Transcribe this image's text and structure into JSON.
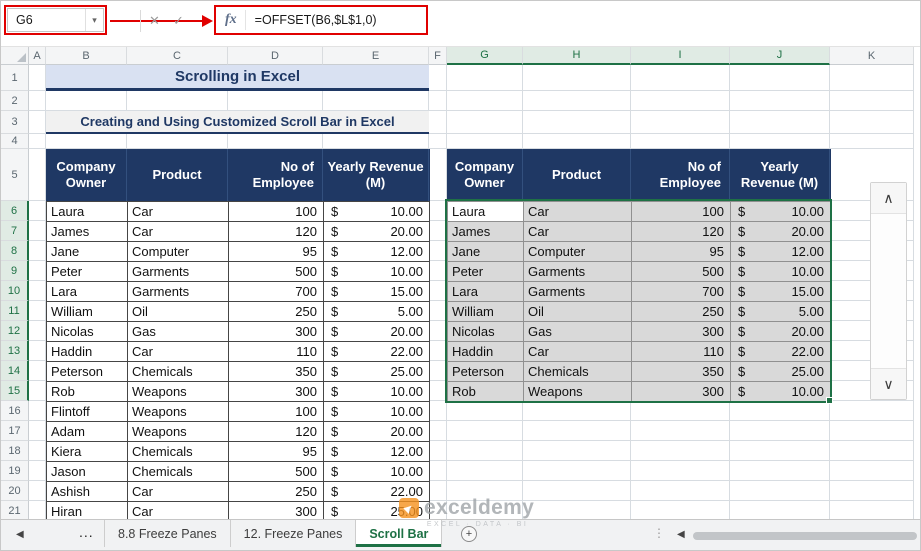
{
  "formula_bar": {
    "name_box_value": "G6",
    "dropdown_icon": "▾",
    "cancel_icon": "✕",
    "enter_icon": "✓",
    "fx_icon": "fx",
    "formula": "=OFFSET(B6,$L$1,0)"
  },
  "grid": {
    "column_headers": [
      "A",
      "B",
      "C",
      "D",
      "E",
      "F",
      "G",
      "H",
      "I",
      "J",
      "K"
    ],
    "selected_columns": [
      "G",
      "H",
      "I",
      "J"
    ],
    "row_headers": [
      "1",
      "2",
      "3",
      "4",
      "5",
      "6",
      "7",
      "8",
      "9",
      "10",
      "11",
      "12",
      "13",
      "14",
      "15",
      "16",
      "17",
      "18",
      "19",
      "20",
      "21"
    ],
    "selected_rows": [
      6,
      7,
      8,
      9,
      10,
      11,
      12,
      13,
      14,
      15
    ]
  },
  "banners": {
    "title": "Scrolling in Excel",
    "subtitle": "Creating and Using Customized Scroll Bar in Excel"
  },
  "table": {
    "headers": [
      "Company Owner",
      "Product",
      "No of Employee",
      "Yearly Revenue (M)"
    ],
    "currency_symbol": "$",
    "left_rows": [
      [
        "Laura",
        "Car",
        "100",
        "10.00"
      ],
      [
        "James",
        "Car",
        "120",
        "20.00"
      ],
      [
        "Jane",
        "Computer",
        "95",
        "12.00"
      ],
      [
        "Peter",
        "Garments",
        "500",
        "10.00"
      ],
      [
        "Lara",
        "Garments",
        "700",
        "15.00"
      ],
      [
        "William",
        "Oil",
        "250",
        "5.00"
      ],
      [
        "Nicolas",
        "Gas",
        "300",
        "20.00"
      ],
      [
        "Haddin",
        "Car",
        "110",
        "22.00"
      ],
      [
        "Peterson",
        "Chemicals",
        "350",
        "25.00"
      ],
      [
        "Rob",
        "Weapons",
        "300",
        "10.00"
      ],
      [
        "Flintoff",
        "Weapons",
        "100",
        "10.00"
      ],
      [
        "Adam",
        "Weapons",
        "120",
        "20.00"
      ],
      [
        "Kiera",
        "Chemicals",
        "95",
        "12.00"
      ],
      [
        "Jason",
        "Chemicals",
        "500",
        "10.00"
      ],
      [
        "Ashish",
        "Car",
        "250",
        "22.00"
      ],
      [
        "Hiran",
        "Car",
        "300",
        "25.00"
      ]
    ],
    "right_rows": [
      [
        "Laura",
        "Car",
        "100",
        "10.00"
      ],
      [
        "James",
        "Car",
        "120",
        "20.00"
      ],
      [
        "Jane",
        "Computer",
        "95",
        "12.00"
      ],
      [
        "Peter",
        "Garments",
        "500",
        "10.00"
      ],
      [
        "Lara",
        "Garments",
        "700",
        "15.00"
      ],
      [
        "William",
        "Oil",
        "250",
        "5.00"
      ],
      [
        "Nicolas",
        "Gas",
        "300",
        "20.00"
      ],
      [
        "Haddin",
        "Car",
        "110",
        "22.00"
      ],
      [
        "Peterson",
        "Chemicals",
        "350",
        "25.00"
      ],
      [
        "Rob",
        "Weapons",
        "300",
        "10.00"
      ]
    ]
  },
  "scrollbar_control": {
    "up_icon": "∧",
    "down_icon": "∨"
  },
  "sheet_bar": {
    "nav_left_icon": "◀",
    "overflow_ellipsis": "...",
    "tabs": [
      "8.8 Freeze Panes",
      "12. Freeze Panes",
      "Scroll Bar"
    ],
    "active_tab": "Scroll Bar",
    "add_sheet_icon": "+",
    "divider_dots": "⋮",
    "hscroll_left_icon": "◀"
  },
  "watermark": {
    "logo_icon": "▶",
    "brand": "exceldemy",
    "tagline": "EXCEL · DATA · BI"
  },
  "colors": {
    "accent_green": "#1E7145",
    "navy": "#1F3864",
    "annotation_red": "#E00000",
    "banner_blue": "#D9E1F2",
    "selection_gray": "#D9D9D9"
  }
}
